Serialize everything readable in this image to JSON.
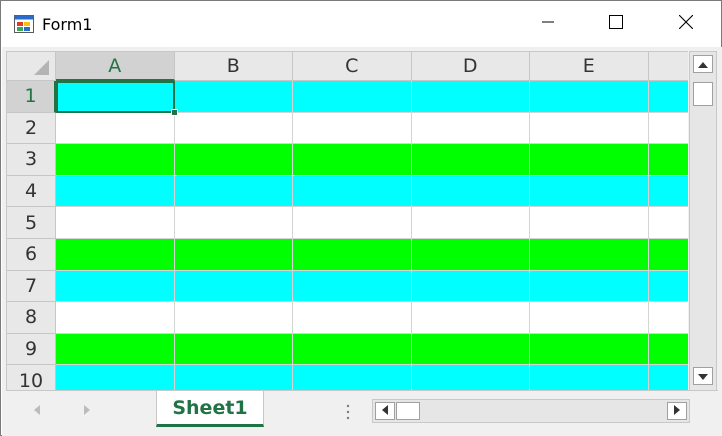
{
  "window": {
    "title": "Form1",
    "icon": "form-app-icon",
    "controls": {
      "minimize": "minimize-icon",
      "maximize": "maximize-icon",
      "close": "close-icon"
    }
  },
  "spreadsheet": {
    "columns": [
      "A",
      "B",
      "C",
      "D",
      "E"
    ],
    "rows": [
      "1",
      "2",
      "3",
      "4",
      "5",
      "6",
      "7",
      "8",
      "9",
      "10"
    ],
    "row_colors": [
      "#00ffff",
      "#ffffff",
      "#00ff00",
      "#00ffff",
      "#ffffff",
      "#00ff00",
      "#00ffff",
      "#ffffff",
      "#00ff00",
      "#00ffff"
    ],
    "active_cell": {
      "column": "A",
      "row": "1"
    },
    "accent_color": "#217346"
  },
  "sheet_tabs": {
    "tabs": [
      {
        "label": "Sheet1",
        "active": true
      }
    ],
    "first_arrow": "triangle-left-icon",
    "next_arrow": "triangle-right-icon"
  },
  "scrollbars": {
    "vertical": {
      "up": "scroll-up-icon",
      "down": "scroll-down-icon"
    },
    "horizontal": {
      "left": "scroll-left-icon",
      "right": "scroll-right-icon"
    }
  }
}
